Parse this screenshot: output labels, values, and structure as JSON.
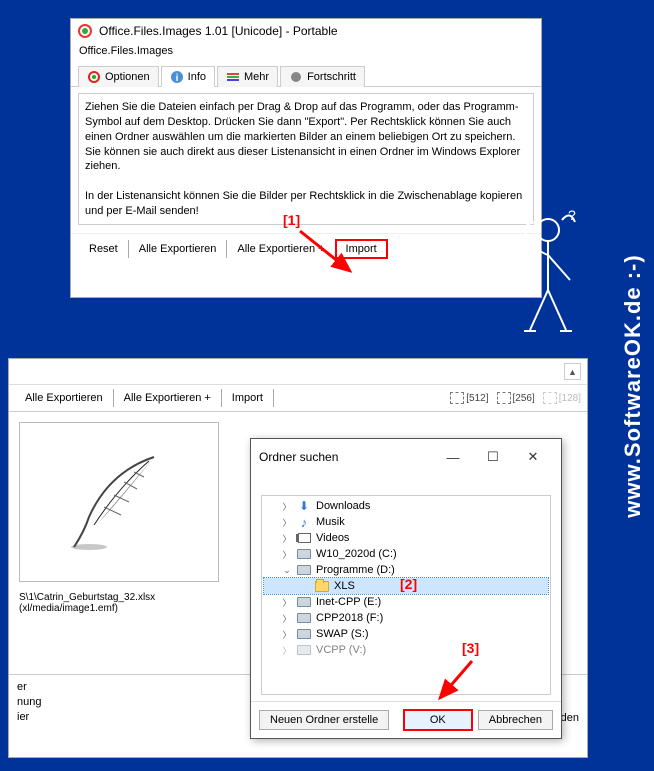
{
  "watermark": "www.SoftwareOK.de :-)",
  "win1": {
    "title": "Office.Files.Images 1.01 [Unicode] - Portable",
    "subtitle": "Office.Files.Images",
    "tabs": {
      "optionen": "Optionen",
      "info": "Info",
      "mehr": "Mehr",
      "fortschritt": "Fortschritt"
    },
    "info_p1": "Ziehen Sie die Dateien einfach per Drag & Drop auf das Programm, oder das Programm-Symbol auf dem Desktop. Drücken Sie dann \"Export\". Per Rechtsklick können Sie auch einen Ordner auswählen um die markierten Bilder an einem beliebigen Ort zu speichern. Sie können sie auch direkt aus dieser Listenansicht in einen Ordner im Windows Explorer ziehen.",
    "info_p2": "In der Listenansicht können Sie die Bilder per Rechtsklick in die Zwischenablage kopieren und per E-Mail senden!",
    "buttons": {
      "reset": "Reset",
      "export_all": "Alle Exportieren",
      "export_all_plus": "Alle Exportieren +",
      "import": "Import"
    }
  },
  "annotations": {
    "a1": "[1]",
    "a2": "[2]",
    "a3": "[3]"
  },
  "win2": {
    "buttons": {
      "export_all": "Alle Exportieren",
      "export_all_plus": "Alle Exportieren +",
      "import": "Import"
    },
    "zoom": {
      "z512": "[512]",
      "z256": "[256]",
      "z128": "[128]"
    },
    "caption_path": "S\\1\\Catrin_Geburtstag_32.xlsx",
    "caption_sub": "(xl/media/image1.emf)",
    "bottom": {
      "l1": "er",
      "l2": "nung",
      "l3": "ier",
      "spenden": "Spenden"
    }
  },
  "dialog": {
    "title": "Ordner suchen",
    "tree": {
      "downloads": "Downloads",
      "musik": "Musik",
      "videos": "Videos",
      "w10": "W10_2020d (C:)",
      "programme": "Programme (D:)",
      "xls": "XLS",
      "inet": "Inet-CPP (E:)",
      "cpp": "CPP2018 (F:)",
      "swap": "SWAP (S:)",
      "vcpp": "VCPP (V:)"
    },
    "new_folder": "Neuen Ordner erstelle",
    "ok": "OK",
    "cancel": "Abbrechen"
  }
}
